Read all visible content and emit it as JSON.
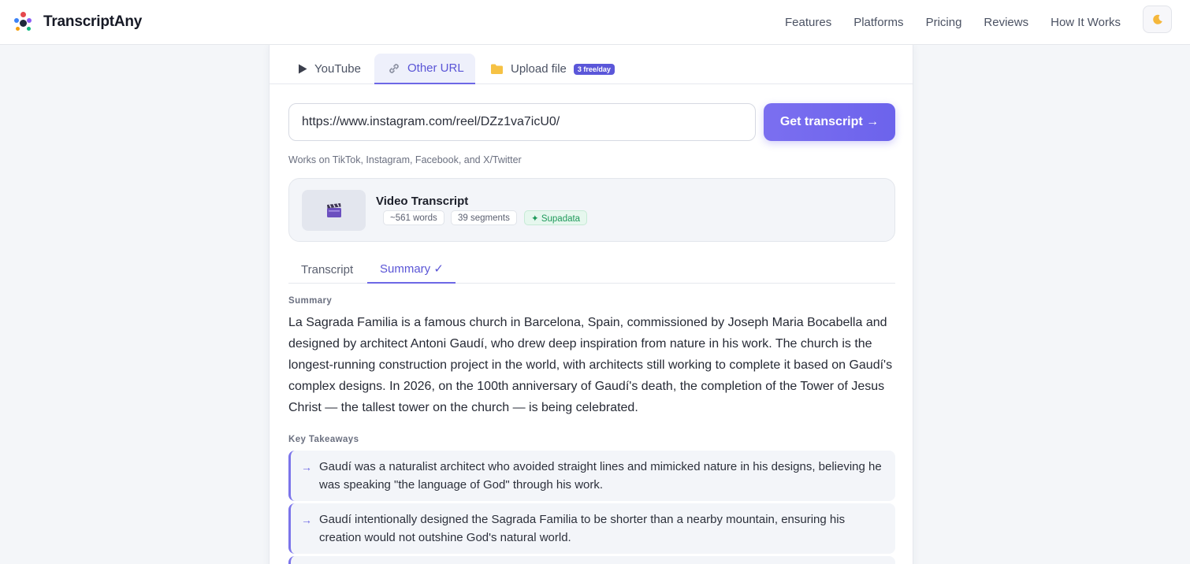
{
  "app": {
    "name": "TranscriptAny",
    "nav": [
      "Features",
      "Platforms",
      "Pricing",
      "Reviews",
      "How It Works"
    ],
    "theme_icon": "moon-icon"
  },
  "source_tabs": [
    {
      "label": "YouTube",
      "icon": "play-icon"
    },
    {
      "label": "Other URL",
      "icon": "link-icon",
      "active": true
    },
    {
      "label": "Upload file",
      "icon": "folder-icon",
      "badge": "3 free/day"
    }
  ],
  "url_input": {
    "value": "https://www.instagram.com/reel/DZz1va7icU0/"
  },
  "get_button": "Get transcript →",
  "hint": "Works on TikTok, Instagram, Facebook, and X/Twitter",
  "video": {
    "thumb_icon": "clapperboard-icon",
    "title": "Video Transcript",
    "words": "~561 words",
    "segments": "39 segments",
    "provider": "✦ Supadata"
  },
  "result_tabs": {
    "transcript": "Transcript",
    "summary": "Summary ✓"
  },
  "summary": {
    "label": "Summary",
    "text": "La Sagrada Familia is a famous church in Barcelona, Spain, commissioned by Joseph Maria Bocabella and designed by architect Antoni Gaudí, who drew deep inspiration from nature in his work. The church is the longest-running construction project in the world, with architects still working to complete it based on Gaudí's complex designs. In 2026, on the 100th anniversary of Gaudí's death, the completion of the Tower of Jesus Christ — the tallest tower on the church — is being celebrated."
  },
  "takeaways": {
    "label": "Key Takeaways",
    "items": [
      "Gaudí was a naturalist architect who avoided straight lines and mimicked nature in his designs, believing he was speaking \"the language of God\" through his work.",
      "Gaudí intentionally designed the Sagrada Familia to be shorter than a nearby mountain, ensuring his creation would not outshine God's natural world."
    ]
  },
  "colors": {
    "accent": "#6c63ec",
    "page_bg": "#f4f6f9",
    "success": "#1f9a5b"
  }
}
